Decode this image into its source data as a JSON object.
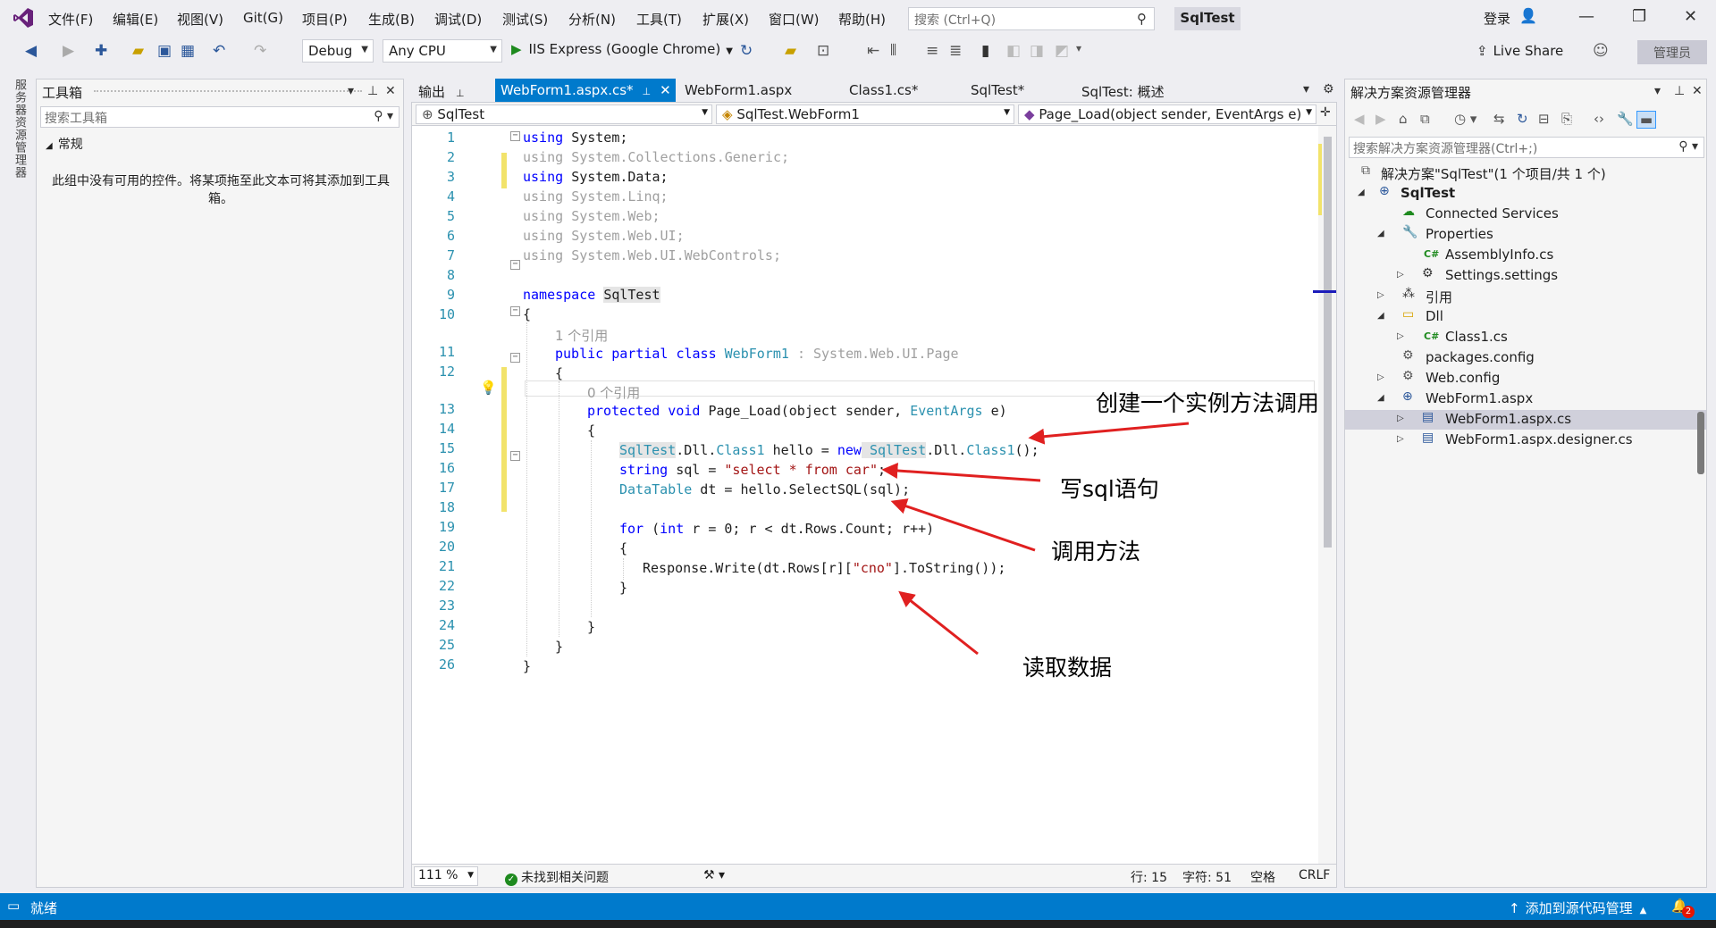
{
  "menu": [
    "文件(F)",
    "编辑(E)",
    "视图(V)",
    "Git(G)",
    "项目(P)",
    "生成(B)",
    "调试(D)",
    "测试(S)",
    "分析(N)",
    "工具(T)",
    "扩展(X)",
    "窗口(W)",
    "帮助(H)"
  ],
  "search": {
    "placeholder": "搜索 (Ctrl+Q)"
  },
  "solution_name": "SqlTest",
  "login": "登录",
  "toolbar": {
    "config": "Debug",
    "platform": "Any CPU",
    "run_label": "IIS Express (Google Chrome)",
    "live_share": "Live Share",
    "admin": "管理员"
  },
  "left_strip": "服务器资源管理器",
  "toolbox": {
    "title": "工具箱",
    "search_placeholder": "搜索工具箱",
    "group": "常规",
    "empty_message": "此组中没有可用的控件。将某项拖至此文本可将其添加到工具箱。"
  },
  "tabs": {
    "output": "输出",
    "active": "WebForm1.aspx.cs*",
    "t2": "WebForm1.aspx",
    "t3": "Class1.cs*",
    "t4": "SqlTest*",
    "t5": "SqlTest: 概述"
  },
  "navbar": {
    "project": "SqlTest",
    "class": "SqlTest.WebForm1",
    "member": "Page_Load(object sender, EventArgs e)"
  },
  "code": {
    "line_numbers": [
      "1",
      "2",
      "3",
      "4",
      "5",
      "6",
      "7",
      "8",
      "9",
      "10",
      "11",
      "12",
      "13",
      "14",
      "15",
      "16",
      "17",
      "18",
      "19",
      "20",
      "21",
      "22",
      "23",
      "24",
      "25",
      "26"
    ],
    "l1": "System;",
    "l2": "System.Collections.Generic;",
    "l3": "System.Data;",
    "l4": "System.Linq;",
    "l5": "System.Web;",
    "l6": "System.Web.UI;",
    "l7": "System.Web.UI.WebControls;",
    "using": "using",
    "namespace": "namespace",
    "ns_name": "SqlTest",
    "refs1": "1 个引用",
    "l11_kw": "public partial class",
    "l11_cls": "WebForm1",
    "l11_base": ": System.Web.UI.Page",
    "refs0": "0 个引用",
    "l13_kw": "protected void",
    "l13_rest": "Page_Load(object sender,",
    "l13_type": "EventArgs",
    "l13_end": "e)",
    "l15_a": "SqlTest",
    "l15_b": ".Dll.",
    "l15_c": "Class1",
    "l15_d": " hello = ",
    "l15_new": "new",
    "l15_e": " SqlTest",
    "l15_f": ".Dll.",
    "l15_g": "Class1",
    "l15_h": "();",
    "l16_kw": "string",
    "l16_a": " sql = ",
    "l16_str": "\"select * from car\"",
    "l16_b": ";",
    "l17_type": "DataTable",
    "l17_rest": " dt = hello.SelectSQL(sql);",
    "l19_kw": "for",
    "l19_a": " (",
    "l19_int": "int",
    "l19_rest": " r = 0; r < dt.Rows.Count; r++)",
    "l21_a": "Response.Write(dt.Rows[r][",
    "l21_str": "\"cno\"",
    "l21_b": "].ToString());",
    "brace_open": "{",
    "brace_close": "}"
  },
  "annotations": {
    "a1": "创建一个实例方法调用",
    "a2": "写sql语句",
    "a3": "调用方法",
    "a4": "读取数据"
  },
  "editor_status": {
    "zoom": "111 %",
    "issues": "未找到相关问题",
    "line": "行: 15",
    "char": "字符: 51",
    "space": "空格",
    "eol": "CRLF"
  },
  "solution_explorer": {
    "title": "解决方案资源管理器",
    "search_placeholder": "搜索解决方案资源管理器(Ctrl+;)",
    "nodes": [
      {
        "label": "解决方案\"SqlTest\"(1 个项目/共 1 个)"
      },
      {
        "label": "SqlTest"
      },
      {
        "label": "Connected Services"
      },
      {
        "label": "Properties"
      },
      {
        "label": "AssemblyInfo.cs"
      },
      {
        "label": "Settings.settings"
      },
      {
        "label": "引用"
      },
      {
        "label": "Dll"
      },
      {
        "label": "Class1.cs"
      },
      {
        "label": "packages.config"
      },
      {
        "label": "Web.config"
      },
      {
        "label": "WebForm1.aspx"
      },
      {
        "label": "WebForm1.aspx.cs"
      },
      {
        "label": "WebForm1.aspx.designer.cs"
      }
    ]
  },
  "statusbar": {
    "ready": "就绪",
    "source_control": "添加到源代码管理",
    "notifications": "2"
  },
  "colors": {
    "accent": "#007acc",
    "keyword": "#0000ff",
    "type": "#2b91af",
    "string": "#a31515",
    "annotation_arrow": "#e02020"
  }
}
